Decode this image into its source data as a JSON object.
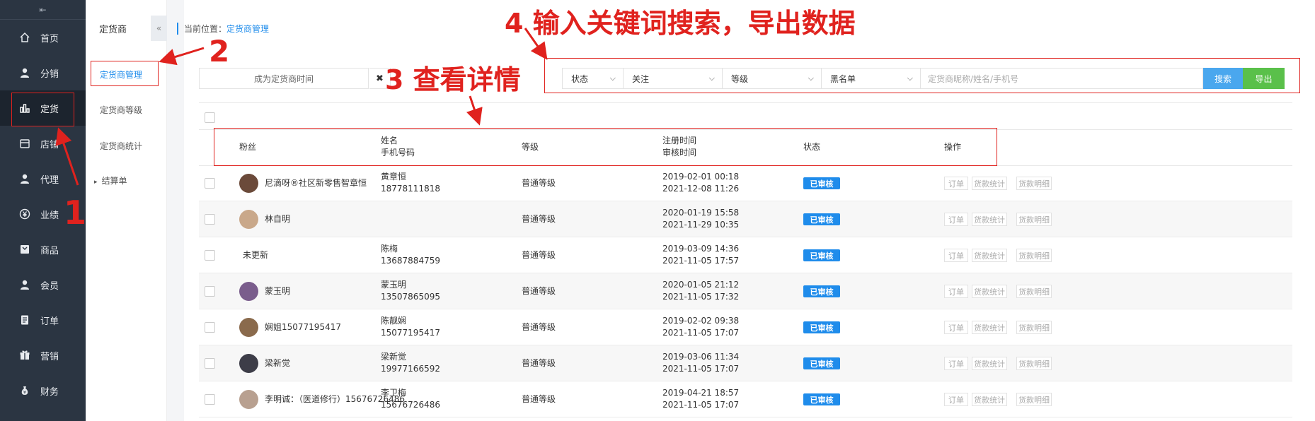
{
  "sidebar": {
    "collapse_glyph": "⇤",
    "items": [
      {
        "label": "首页",
        "icon": "home-icon"
      },
      {
        "label": "分销",
        "icon": "user-icon"
      },
      {
        "label": "定货",
        "icon": "bar-chart-icon"
      },
      {
        "label": "店铺",
        "icon": "store-icon"
      },
      {
        "label": "代理",
        "icon": "agent-icon"
      },
      {
        "label": "业绩",
        "icon": "yen-icon"
      },
      {
        "label": "商品",
        "icon": "goods-icon"
      },
      {
        "label": "会员",
        "icon": "member-icon"
      },
      {
        "label": "订单",
        "icon": "order-icon"
      },
      {
        "label": "营销",
        "icon": "gift-icon"
      },
      {
        "label": "财务",
        "icon": "money-bag-icon"
      }
    ],
    "active_index": 2
  },
  "submenu": {
    "title": "定货商",
    "collapse_glyph": "«",
    "items": [
      {
        "label": "定货商管理"
      },
      {
        "label": "定货商等级"
      },
      {
        "label": "定货商统计"
      },
      {
        "label": "结算单"
      }
    ],
    "expand_glyph": "▸"
  },
  "breadcrumb": {
    "prefix": "当前位置：",
    "current": "定货商管理"
  },
  "filters": {
    "date_label": "成为定货商时间",
    "clear_glyph": "✖",
    "status": "状态",
    "follow": "关注",
    "level": "等级",
    "blacklist": "黑名单",
    "search_placeholder": "定货商昵称/姓名/手机号",
    "search_button": "搜索",
    "export_button": "导出"
  },
  "table": {
    "headers": {
      "fans": "粉丝",
      "name": "姓名",
      "phone": "手机号码",
      "level": "等级",
      "register_time": "注册时间",
      "review_time": "审核时间",
      "status": "状态",
      "action": "操作"
    },
    "rows": [
      {
        "fan": "尼滴呀®社区新零售智章恒",
        "name": "黄章恒",
        "phone": "18778111818",
        "level": "普通等级",
        "register": "2019-02-01 00:18",
        "review": "2021-12-08 11:26",
        "status": "已审核"
      },
      {
        "fan": "林自明",
        "name": "",
        "phone": "",
        "level": "普通等级",
        "register": "2020-01-19 15:58",
        "review": "2021-11-29 10:35",
        "status": "已审核"
      },
      {
        "fan": "未更新",
        "name": "陈梅",
        "phone": "13687884759",
        "level": "普通等级",
        "register": "2019-03-09 14:36",
        "review": "2021-11-05 17:57",
        "status": "已审核"
      },
      {
        "fan": "蒙玉明",
        "name": "蒙玉明",
        "phone": "13507865095",
        "level": "普通等级",
        "register": "2020-01-05 21:12",
        "review": "2021-11-05 17:32",
        "status": "已审核"
      },
      {
        "fan": "娴姐15077195417",
        "name": "陈靓娴",
        "phone": "15077195417",
        "level": "普通等级",
        "register": "2019-02-02 09:38",
        "review": "2021-11-05 17:07",
        "status": "已审核"
      },
      {
        "fan": "梁新觉",
        "name": "梁新觉",
        "phone": "19977166592",
        "level": "普通等级",
        "register": "2019-03-06 11:34",
        "review": "2021-11-05 17:07",
        "status": "已审核"
      },
      {
        "fan": "李明诚：（医道修行）15676726486",
        "name": "李卫梅",
        "phone": "15676726486",
        "level": "普通等级",
        "register": "2019-04-21 18:57",
        "review": "2021-11-05 17:07",
        "status": "已审核"
      }
    ],
    "actions": [
      "订单",
      "货款统计",
      "货款明细"
    ]
  },
  "annotations": {
    "n1": "1",
    "n2": "2",
    "n3": "3 查看详情",
    "n4": "4 输入关键词搜索，导出数据"
  },
  "colors": {
    "sidebar_bg": "#2b3542",
    "accent": "#1f8ceb",
    "search_btn": "#4aa7ee",
    "export_btn": "#5ac04a",
    "annotation": "#e0221e"
  }
}
